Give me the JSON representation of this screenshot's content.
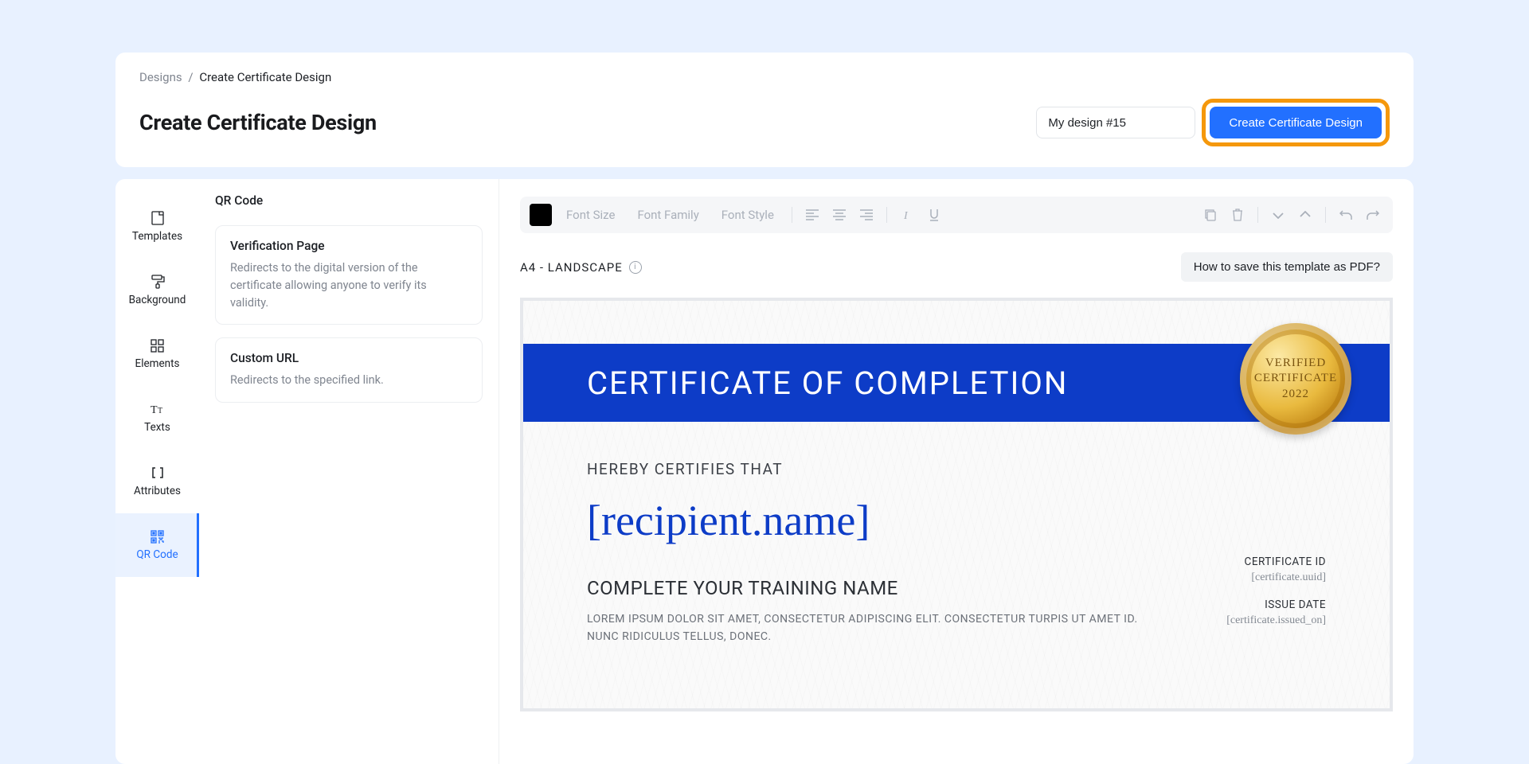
{
  "breadcrumb": {
    "root": "Designs",
    "current": "Create Certificate Design"
  },
  "page_title": "Create Certificate Design",
  "design_name_input": "My design #15",
  "create_button_label": "Create Certificate Design",
  "sidebar": {
    "items": [
      {
        "label": "Templates"
      },
      {
        "label": "Background"
      },
      {
        "label": "Elements"
      },
      {
        "label": "Texts"
      },
      {
        "label": "Attributes"
      },
      {
        "label": "QR Code"
      }
    ]
  },
  "panel": {
    "title": "QR Code",
    "options": [
      {
        "title": "Verification Page",
        "desc": "Redirects to the digital version of the certificate allowing anyone to verify its validity."
      },
      {
        "title": "Custom URL",
        "desc": "Redirects to the specified link."
      }
    ]
  },
  "toolbar": {
    "font_size": "Font Size",
    "font_family": "Font Family",
    "font_style": "Font Style"
  },
  "canvas": {
    "format": "A4 - LANDSCAPE",
    "help_label": "How to save this template as PDF?"
  },
  "certificate": {
    "banner_title": "CERTIFICATE OF COMPLETION",
    "seal_line1": "VERIFIED",
    "seal_line2": "CERTIFICATE",
    "seal_line3": "2022",
    "hereby": "HEREBY CERTIFIES THAT",
    "recipient": "[recipient.name]",
    "training": "COMPLETE YOUR TRAINING NAME",
    "lorem": "LOREM IPSUM DOLOR SIT AMET, CONSECTETUR ADIPISCING ELIT. CONSECTETUR TURPIS UT AMET ID. NUNC RIDICULUS TELLUS, DONEC.",
    "meta1_label": "CERTIFICATE ID",
    "meta1_value": "[certificate.uuid]",
    "meta2_label": "ISSUE DATE",
    "meta2_value": "[certificate.issued_on]"
  }
}
